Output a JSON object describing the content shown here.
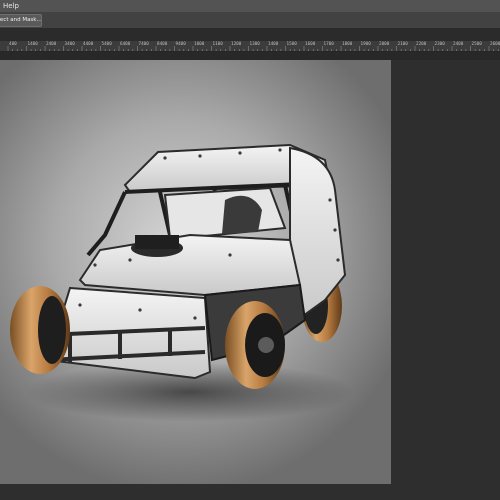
{
  "menubar": {
    "items": [
      "Help"
    ]
  },
  "optionsbar": {
    "select_and_mask": "elect and Mask..."
  },
  "ruler": {
    "ticks": [
      "400",
      "1400",
      "2400",
      "3400",
      "4400",
      "5400",
      "6400",
      "7400",
      "8400",
      "9400",
      "1000",
      "1100",
      "1200",
      "1300",
      "1400",
      "1500",
      "1600",
      "1700",
      "1800",
      "1900",
      "2000",
      "2100",
      "2200",
      "2300",
      "2400",
      "2500",
      "2600"
    ]
  },
  "canvas": {
    "artwork": "dirt modified race car illustration"
  },
  "colors": {
    "menubar": "#535353",
    "options_bar": "#424242",
    "workspace": "#282828",
    "tire": "#c08a52"
  },
  "icons": {
    "left_tool_strip": "collapsed-panel-icon"
  }
}
